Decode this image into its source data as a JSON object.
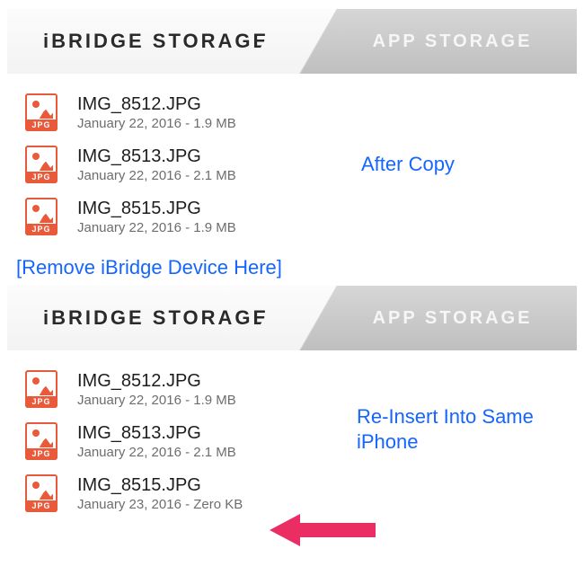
{
  "top": {
    "tabs": {
      "active": "iBRIDGE STORAGE",
      "inactive": "APP STORAGE"
    },
    "files": [
      {
        "name": "IMG_8512.JPG",
        "meta": "January 22, 2016 - 1.9 MB",
        "badge": "JPG"
      },
      {
        "name": "IMG_8513.JPG",
        "meta": "January 22, 2016 - 2.1 MB",
        "badge": "JPG"
      },
      {
        "name": "IMG_8515.JPG",
        "meta": "January 22, 2016 - 1.9 MB",
        "badge": "JPG"
      }
    ]
  },
  "bottom": {
    "tabs": {
      "active": "iBRIDGE STORAGE",
      "inactive": "APP STORAGE"
    },
    "files": [
      {
        "name": "IMG_8512.JPG",
        "meta": "January 22, 2016 - 1.9 MB",
        "badge": "JPG"
      },
      {
        "name": "IMG_8513.JPG",
        "meta": "January 22, 2016 - 2.1 MB",
        "badge": "JPG"
      },
      {
        "name": "IMG_8515.JPG",
        "meta": "January 23, 2016 - Zero KB",
        "badge": "JPG"
      }
    ]
  },
  "annotations": {
    "after_copy": "After Copy",
    "remove_device": "[Remove iBridge Device Here]",
    "reinsert": "Re-Insert Into Same iPhone"
  }
}
